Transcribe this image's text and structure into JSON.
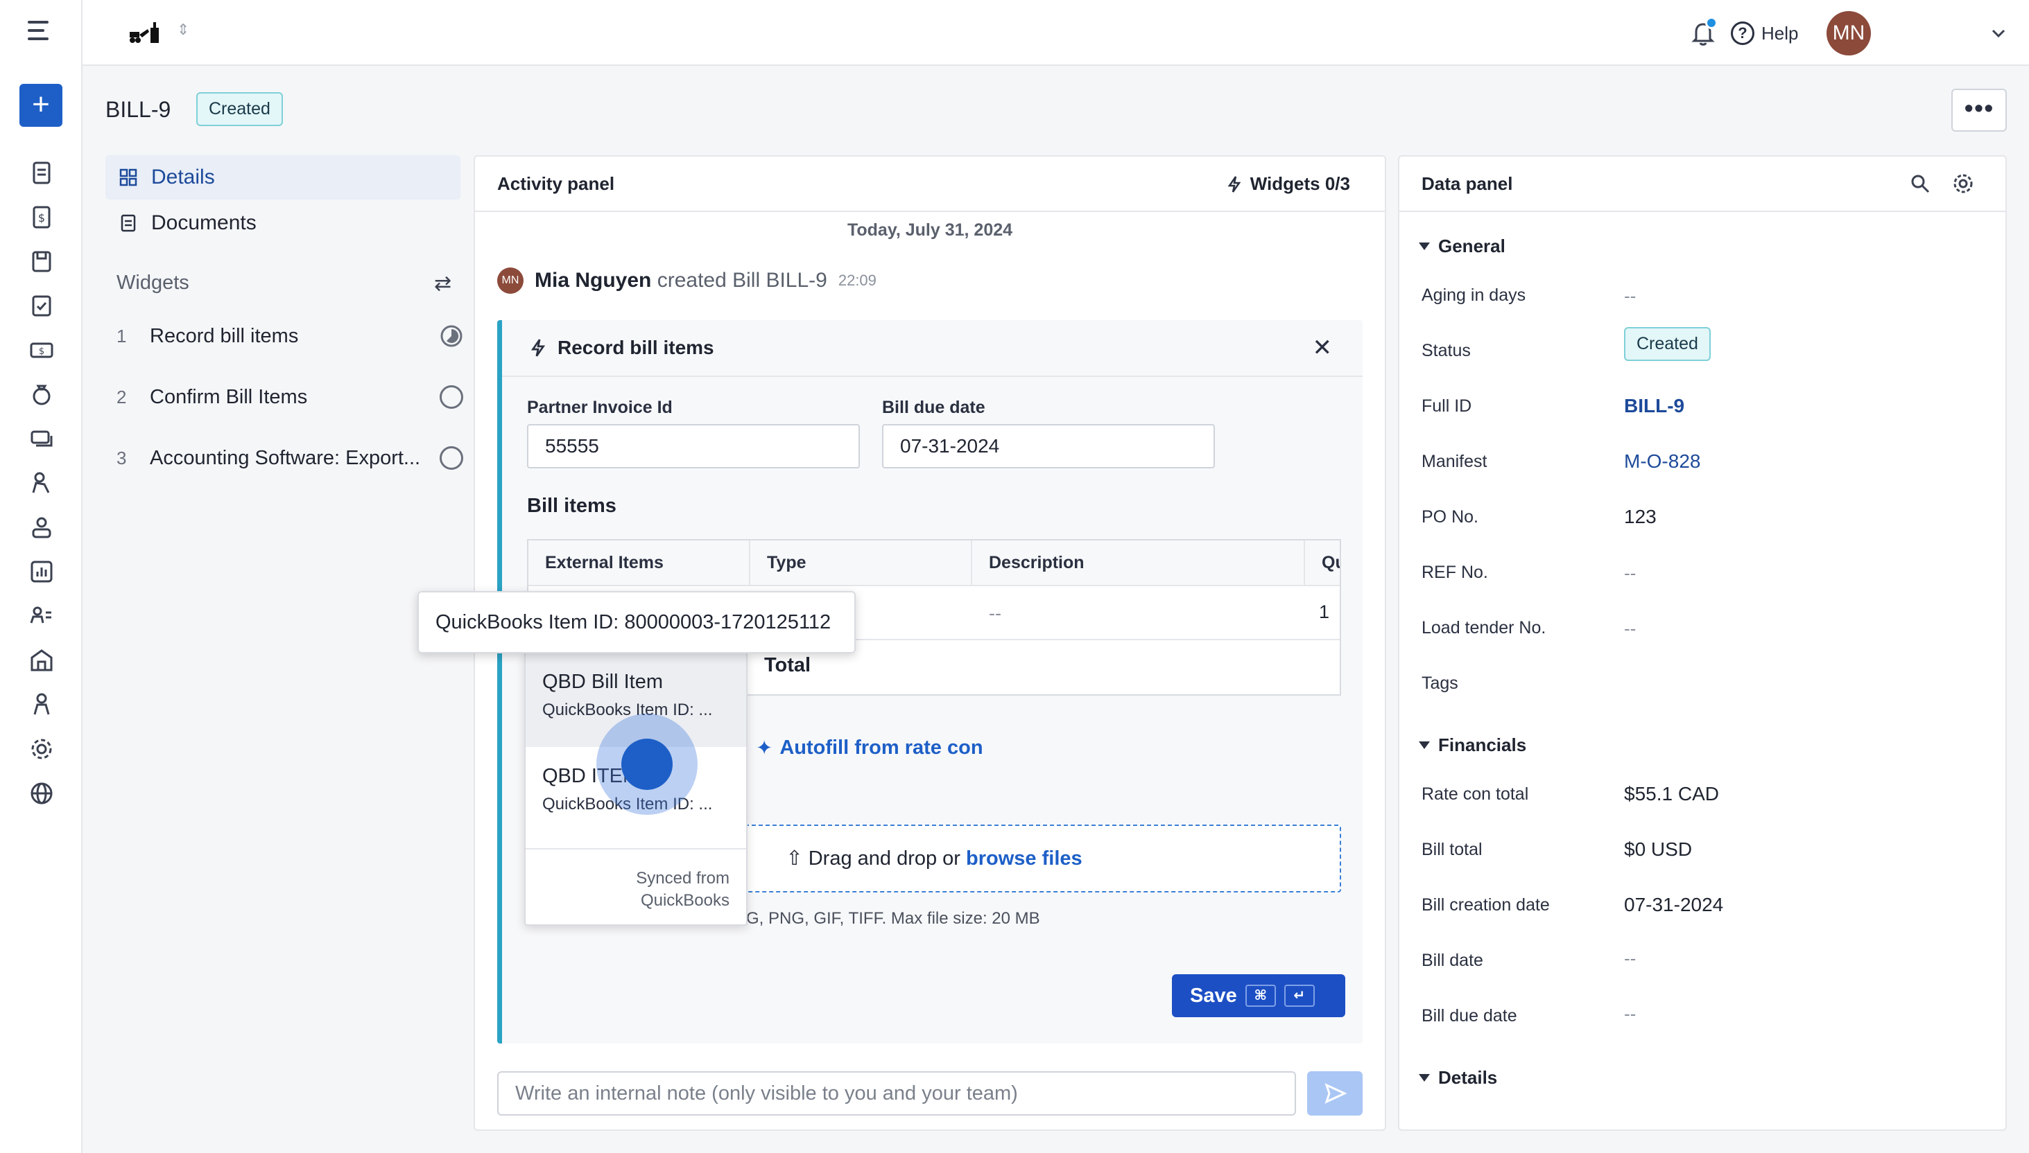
{
  "header": {
    "bill_id": "BILL-9",
    "status": "Created",
    "help_label": "Help",
    "user_initials": "MN"
  },
  "nav": {
    "details": "Details",
    "documents": "Documents",
    "widgets_heading": "Widgets",
    "widgets": [
      {
        "num": "1",
        "label": "Record bill items"
      },
      {
        "num": "2",
        "label": "Confirm Bill Items"
      },
      {
        "num": "3",
        "label": "Accounting Software: Export..."
      }
    ]
  },
  "activity": {
    "title": "Activity panel",
    "widgets_count": "Widgets 0/3",
    "date": "Today, July 31, 2024",
    "event": {
      "avatar": "MN",
      "actor": "Mia Nguyen",
      "action": "created Bill BILL-9",
      "time": "22:09"
    },
    "widget": {
      "title": "Record bill items",
      "partner_invoice_label": "Partner Invoice Id",
      "partner_invoice_value": "55555",
      "due_date_label": "Bill due date",
      "due_date_value": "07-31-2024",
      "bill_items_title": "Bill items",
      "columns": [
        "External Items",
        "Type",
        "Description",
        "Qu"
      ],
      "row": {
        "description": "--",
        "quantity": "1"
      },
      "total_label": "Total",
      "autofill": "Autofill from rate con",
      "drop_text": "Drag and drop or",
      "browse": "browse files",
      "hint": "G, PNG, GIF, TIFF. Max file size: 20 MB",
      "save": "Save"
    },
    "note_placeholder": "Write an internal note (only visible to you and your team)"
  },
  "dropdown": {
    "tooltip": "QuickBooks Item ID: 80000003-1720125112",
    "items": [
      {
        "name": "QBD Bill Item",
        "sub": "QuickBooks Item ID: ..."
      },
      {
        "name": "QBD ITEM",
        "sub": "QuickBooks Item ID: ..."
      }
    ],
    "footer_line1": "Synced from",
    "footer_line2": "QuickBooks"
  },
  "data_panel": {
    "title": "Data panel",
    "general": "General",
    "fields": [
      {
        "label": "Aging in days",
        "value": "--"
      },
      {
        "label": "Status",
        "value": "Created"
      },
      {
        "label": "Full ID",
        "value": "BILL-9"
      },
      {
        "label": "Manifest",
        "value": "M-O-828"
      },
      {
        "label": "PO No.",
        "value": "123"
      },
      {
        "label": "REF No.",
        "value": "--"
      },
      {
        "label": "Load tender No.",
        "value": "--"
      },
      {
        "label": "Tags",
        "value": ""
      }
    ],
    "financials": "Financials",
    "fin_fields": [
      {
        "label": "Rate con total",
        "value": "$55.1 CAD"
      },
      {
        "label": "Bill total",
        "value": "$0 USD"
      },
      {
        "label": "Bill creation date",
        "value": "07-31-2024"
      },
      {
        "label": "Bill date",
        "value": "--"
      },
      {
        "label": "Bill due date",
        "value": "--"
      }
    ],
    "details": "Details"
  }
}
